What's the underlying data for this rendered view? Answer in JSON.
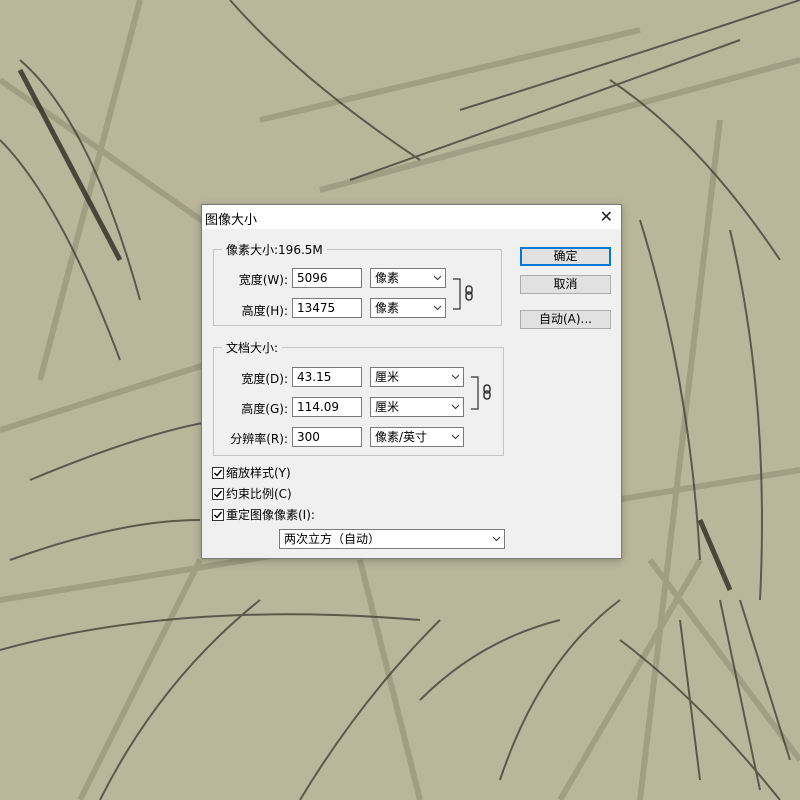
{
  "dialog": {
    "title": "图像大小",
    "close_label": "✕",
    "pixel_group": {
      "legend": "像素大小:196.5M",
      "width_label": "宽度(W):",
      "width_value": "5096",
      "width_unit": "像素",
      "height_label": "高度(H):",
      "height_value": "13475",
      "height_unit": "像素"
    },
    "doc_group": {
      "legend": "文档大小:",
      "width_label": "宽度(D):",
      "width_value": "43.15",
      "width_unit": "厘米",
      "height_label": "高度(G):",
      "height_value": "114.09",
      "height_unit": "厘米",
      "res_label": "分辨率(R):",
      "res_value": "300",
      "res_unit": "像素/英寸"
    },
    "checks": {
      "scale_styles": {
        "label": "缩放样式(Y)",
        "checked": true
      },
      "constrain": {
        "label": "约束比例(C)",
        "checked": true
      },
      "resample": {
        "label": "重定图像像素(I):",
        "checked": true
      }
    },
    "resample_method": "两次立方（自动）",
    "buttons": {
      "ok": "确定",
      "cancel": "取消",
      "auto": "自动(A)..."
    }
  }
}
